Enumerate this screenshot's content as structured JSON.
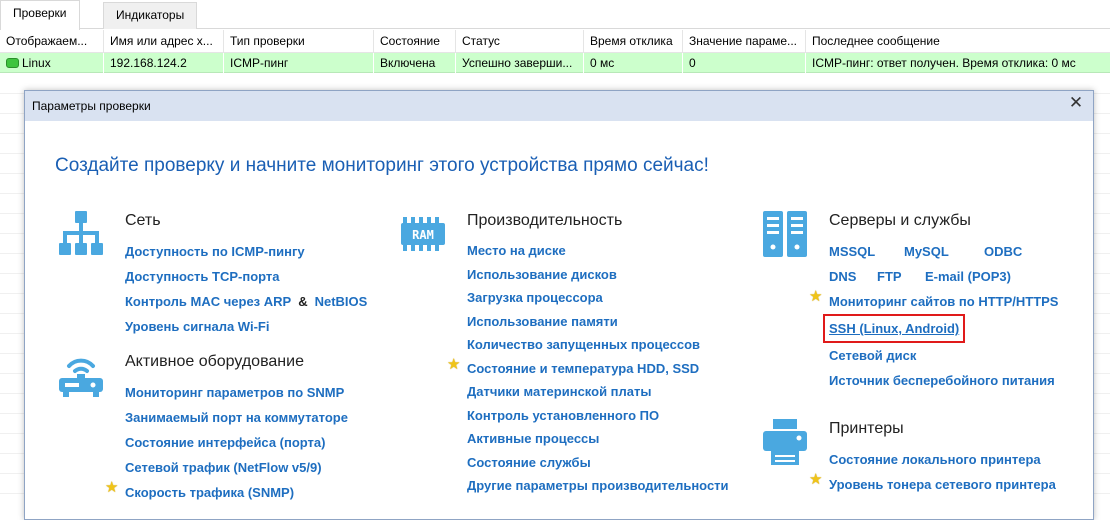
{
  "tabs": [
    {
      "label": "Проверки",
      "active": true
    },
    {
      "label": "Индикаторы",
      "active": false
    }
  ],
  "table": {
    "headers": [
      "Отображаем...",
      "Имя или адрес х...",
      "Тип проверки",
      "Состояние",
      "Статус",
      "Время отклика",
      "Значение параме...",
      "Последнее сообщение"
    ],
    "rows": [
      [
        "Linux",
        "192.168.124.2",
        "ICMP-пинг",
        "Включена",
        "Успешно заверши...",
        "0 мс",
        "0",
        "ICMP-пинг: ответ получен. Время отклика: 0 мс"
      ]
    ],
    "row_color": "#ccffcc"
  },
  "dialog": {
    "title": "Параметры проверки",
    "headline": "Создайте проверку и начните мониторинг этого устройства прямо сейчас!",
    "accent_color": "#1e6ec0",
    "columns": [
      {
        "sections": [
          {
            "title": "Сеть",
            "icon": "network-icon",
            "links": [
              {
                "label": "Доступность по ICMP-пингу"
              },
              {
                "label": "Доступность TCP-порта"
              },
              {
                "label": "Контроль MAC через ARP",
                "amp": "&",
                "extra": "NetBIOS"
              },
              {
                "label": "Уровень сигнала Wi-Fi"
              }
            ]
          },
          {
            "title": "Активное оборудование",
            "icon": "router-icon",
            "links": [
              {
                "label": "Мониторинг параметров по SNMP"
              },
              {
                "label": "Занимаемый порт на коммутаторе"
              },
              {
                "label": "Состояние интерфейса (порта)"
              },
              {
                "label": "Сетевой трафик (NetFlow v5/9)"
              },
              {
                "label": "Скорость трафика (SNMP)",
                "star": true
              }
            ]
          }
        ]
      },
      {
        "sections": [
          {
            "title": "Производительность",
            "icon": "ram-icon",
            "icon_text": "RAM",
            "links": [
              {
                "label": "Место на диске"
              },
              {
                "label": "Использование дисков"
              },
              {
                "label": "Загрузка процессора"
              },
              {
                "label": "Использование памяти"
              },
              {
                "label": "Количество запущенных процессов"
              },
              {
                "label": "Состояние и температура HDD, SSD",
                "star": true
              },
              {
                "label": "Датчики материнской платы"
              },
              {
                "label": "Контроль установленного ПО"
              },
              {
                "label": "Активные процессы"
              },
              {
                "label": "Состояние службы"
              },
              {
                "label": "Другие параметры производительности"
              }
            ]
          }
        ]
      },
      {
        "sections": [
          {
            "title": "Серверы и службы",
            "icon": "servers-icon",
            "inline_rows": [
              [
                "MSSQL",
                "MySQL",
                "ODBC"
              ],
              [
                "DNS",
                "FTP",
                "E-mail (POP3)"
              ]
            ],
            "links": [
              {
                "label": "Мониторинг сайтов по HTTP/HTTPS",
                "star": true
              },
              {
                "label": "SSH (Linux, Android)",
                "highlighted": true
              },
              {
                "label": "Сетевой диск"
              },
              {
                "label": "Источник бесперебойного питания"
              }
            ]
          },
          {
            "title": "Принтеры",
            "icon": "printer-icon",
            "links": [
              {
                "label": "Состояние локального принтера"
              },
              {
                "label": "Уровень тонера сетевого принтера",
                "star": true
              }
            ]
          }
        ]
      }
    ]
  }
}
